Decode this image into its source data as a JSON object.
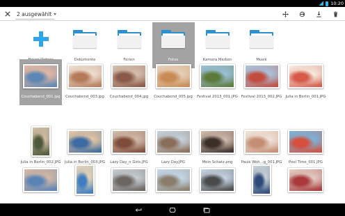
{
  "status_bar": {
    "time": "10:20"
  },
  "action_bar": {
    "selection_label": "2 ausgewählt",
    "actions": [
      {
        "name": "move-icon"
      },
      {
        "name": "share-link-icon"
      },
      {
        "name": "download-icon"
      },
      {
        "name": "delete-icon"
      }
    ]
  },
  "colors": {
    "accent": "#2ea6e8",
    "folder": "#2d91cf",
    "selected_bg": "#a3a3a3"
  },
  "grid": {
    "items": [
      {
        "type": "new",
        "label": "Neuer Ordner",
        "selected": false
      },
      {
        "type": "folder",
        "label": "Dokumente",
        "selected": false
      },
      {
        "type": "folder",
        "label": "Ferien",
        "selected": false
      },
      {
        "type": "folder",
        "label": "Fotos",
        "selected": true
      },
      {
        "type": "folder",
        "label": "Kamera Medien",
        "selected": false
      },
      {
        "type": "folder",
        "label": "Musik",
        "selected": false
      },
      {
        "type": "photo",
        "label": "Couchabend_001.jpg",
        "selected": true,
        "colors": [
          "#e8b9a0",
          "#5c87b5"
        ]
      },
      {
        "type": "photo",
        "label": "Couchabend_003.jpg",
        "selected": false,
        "colors": [
          "#f0e3d6",
          "#b47a5a"
        ]
      },
      {
        "type": "photo",
        "label": "Couchabend_004.jpg",
        "selected": false,
        "colors": [
          "#d9c4b1",
          "#8a5a48"
        ]
      },
      {
        "type": "photo",
        "label": "Couchabend_005.jpg",
        "selected": false,
        "colors": [
          "#e7d3bd",
          "#c98b55"
        ]
      },
      {
        "type": "photo",
        "label": "Festival 2013_001.JPG",
        "selected": false,
        "colors": [
          "#9cc4e0",
          "#5d7a3b"
        ]
      },
      {
        "type": "photo",
        "label": "Festival 2013_002.JPG",
        "selected": false,
        "colors": [
          "#a7c9e4",
          "#c24d3e"
        ]
      },
      {
        "type": "photo",
        "label": "Julia in Berlin_001.JPG",
        "selected": false,
        "colors": [
          "#f7f1e5",
          "#d65a47"
        ]
      },
      {
        "type": "photo",
        "label": "Julia in Berlin_002.JPG",
        "selected": false,
        "tall": true,
        "colors": [
          "#d7c0a9",
          "#4d5a3a"
        ]
      },
      {
        "type": "photo",
        "label": "Julia in Berlin_003.JPG",
        "selected": false,
        "colors": [
          "#eac9a3",
          "#3c6aa1"
        ]
      },
      {
        "type": "photo",
        "label": "Lazy Day_n Girls.JPG",
        "selected": false,
        "colors": [
          "#d5bfae",
          "#7f4c3a"
        ]
      },
      {
        "type": "photo",
        "label": "Lazy Day.JPG",
        "selected": false,
        "colors": [
          "#c6d6e3",
          "#8b6e58"
        ]
      },
      {
        "type": "photo",
        "label": "Mein Schatz.png",
        "selected": false,
        "colors": [
          "#d6c0b0",
          "#3b2f2a"
        ]
      },
      {
        "type": "photo",
        "label": "Pauls Woh...g_001.JPG",
        "selected": false,
        "colors": [
          "#f3e6dd",
          "#c48e73"
        ]
      },
      {
        "type": "photo",
        "label": "Pool Time_001.JPG",
        "selected": false,
        "colors": [
          "#78b8e0",
          "#d54f3c"
        ]
      },
      {
        "type": "photo",
        "label": "",
        "selected": false,
        "colors": [
          "#d9b9a2",
          "#5a84b6"
        ]
      },
      {
        "type": "photo",
        "label": "",
        "selected": false,
        "tall": true,
        "colors": [
          "#ecd6b6",
          "#3e7dbf"
        ]
      },
      {
        "type": "photo",
        "label": "",
        "selected": false,
        "colors": [
          "#c9d0d6",
          "#6b6560"
        ]
      },
      {
        "type": "photo",
        "label": "",
        "selected": false,
        "colors": [
          "#c6dbed",
          "#8b7d6b"
        ]
      },
      {
        "type": "photo",
        "label": "",
        "selected": false,
        "colors": [
          "#c9d9e8",
          "#4a4a4a"
        ]
      },
      {
        "type": "photo",
        "label": "",
        "selected": false,
        "tall": true,
        "colors": [
          "#cfd7da",
          "#2f4a7a"
        ]
      },
      {
        "type": "photo",
        "label": "",
        "selected": false,
        "colors": [
          "#e4d2c8",
          "#a8383a"
        ]
      }
    ]
  },
  "nav_bar": {
    "buttons": [
      "back-icon",
      "home-icon",
      "recent-apps-icon"
    ]
  }
}
